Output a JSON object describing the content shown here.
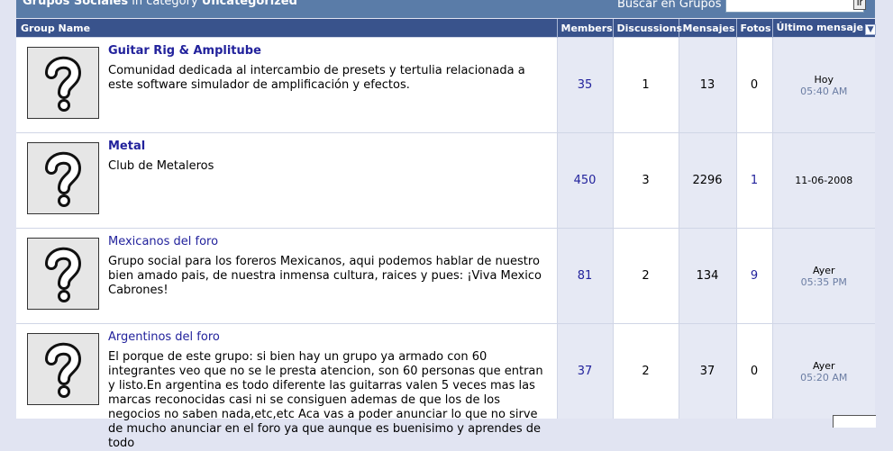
{
  "header": {
    "title_bold": "Grupos Sociales",
    "title_mid": " in category ",
    "title_category": "Uncategorized",
    "search_label": "Buscar en Grupos",
    "search_value": "",
    "go_label": "Ir"
  },
  "columns": {
    "name": "Group Name",
    "members": "Members",
    "discussions": "Discussions",
    "messages": "Mensajes",
    "photos": "Fotos",
    "last": "Último mensaje"
  },
  "groups": [
    {
      "name": "Guitar Rig & Amplitube",
      "description": "Comunidad dedicada al intercambio de presets y tertulia relacionada a este software simulador de amplificación y efectos.",
      "members": "35",
      "discussions": "1",
      "messages": "13",
      "photos": "0",
      "last_date": "Hoy",
      "last_time": "05:40 AM"
    },
    {
      "name": "Metal",
      "description": "Club de Metaleros",
      "members": "450",
      "discussions": "3",
      "messages": "2296",
      "photos": "1",
      "last_date": "11-06-2008",
      "last_time": ""
    },
    {
      "name": "Mexicanos del foro",
      "description": "Grupo social para los foreros Mexicanos, aqui podemos hablar de nuestro bien amado pais, de nuestra inmensa cultura, raices y pues: ¡Viva Mexico Cabrones!",
      "members": "81",
      "discussions": "2",
      "messages": "134",
      "photos": "9",
      "last_date": "Ayer",
      "last_time": "05:35 PM"
    },
    {
      "name": "Argentinos del foro",
      "description": "El porque de este grupo: si bien hay un grupo ya armado con 60 integrantes veo que no se le presta atencion, son 60 personas que entran y listo.En argentina es todo diferente las guitarras valen 5 veces mas las marcas reconocidas casi ni se consiguen ademas de que los de los negocios no saben nada,etc,etc Aca vas a poder anunciar lo que no sirve de mucho anunciar en el foro ya que aunque es buenisimo y aprendes de todo",
      "members": "37",
      "discussions": "2",
      "messages": "37",
      "photos": "0",
      "last_date": "Ayer",
      "last_time": "05:20 AM"
    }
  ]
}
